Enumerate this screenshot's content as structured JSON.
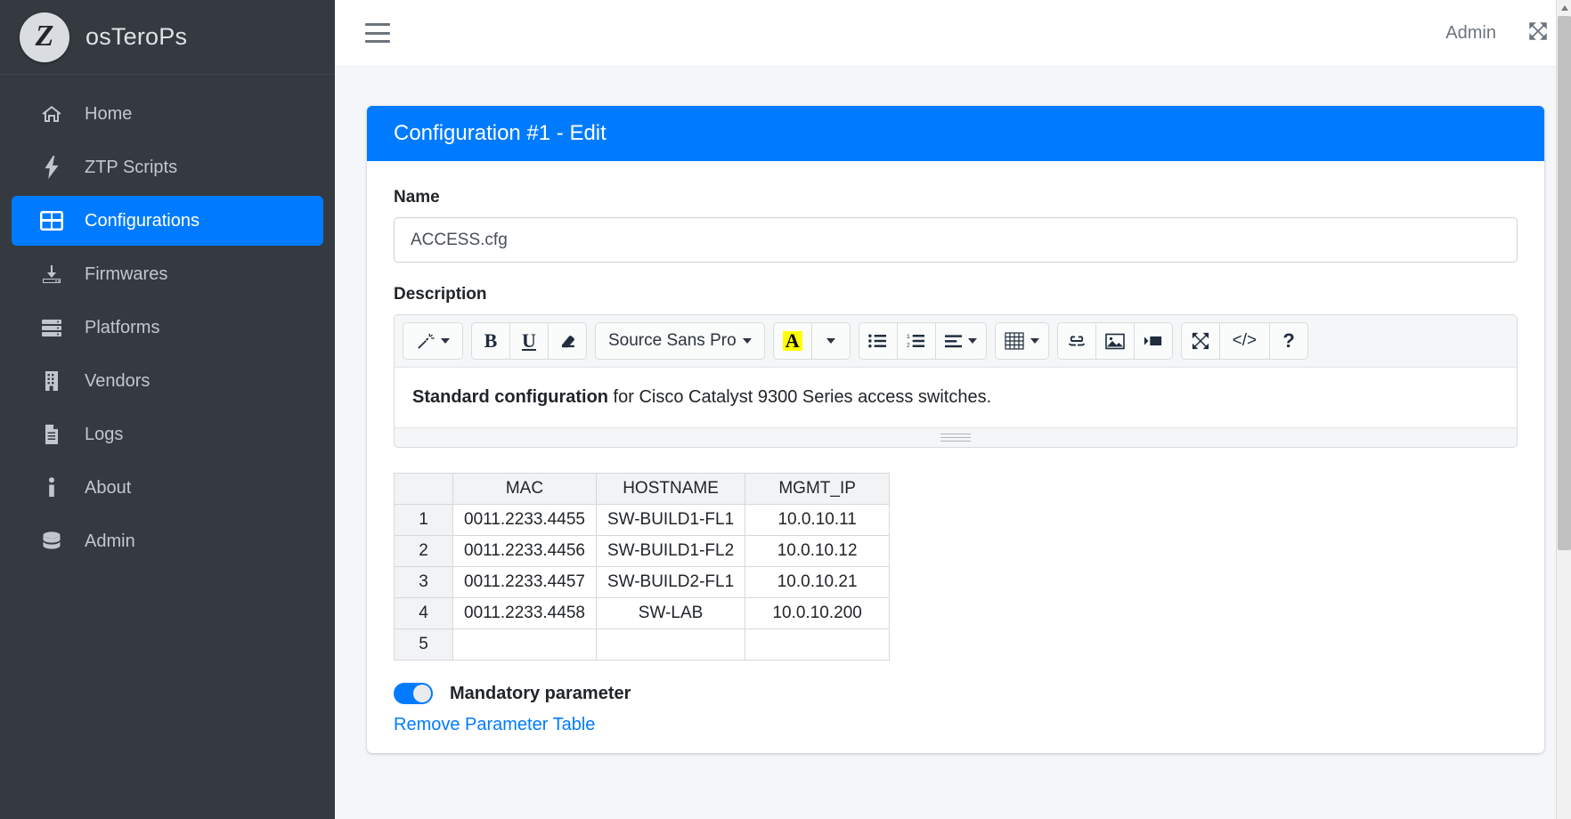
{
  "brand": {
    "logo_letter": "Z",
    "title": "osTeroPs"
  },
  "sidebar": {
    "items": [
      {
        "label": "Home",
        "icon": "home-icon",
        "active": false
      },
      {
        "label": "ZTP Scripts",
        "icon": "bolt-icon",
        "active": false
      },
      {
        "label": "Configurations",
        "icon": "table-icon",
        "active": true
      },
      {
        "label": "Firmwares",
        "icon": "download-icon",
        "active": false
      },
      {
        "label": "Platforms",
        "icon": "server-icon",
        "active": false
      },
      {
        "label": "Vendors",
        "icon": "building-icon",
        "active": false
      },
      {
        "label": "Logs",
        "icon": "file-lines-icon",
        "active": false
      },
      {
        "label": "About",
        "icon": "info-icon",
        "active": false
      },
      {
        "label": "Admin",
        "icon": "database-icon",
        "active": false
      }
    ],
    "active_color": "#007bff",
    "background": "#343a40"
  },
  "topbar": {
    "menu_icon": "hamburger-icon",
    "user_label": "Admin",
    "expand_icon": "expand-arrows-icon"
  },
  "card": {
    "header_title": "Configuration #1 - Edit",
    "header_color": "#007bff"
  },
  "form": {
    "name_label": "Name",
    "name_value": "ACCESS.cfg",
    "name_placeholder": "Name",
    "description_label": "Description"
  },
  "editor": {
    "toolbar": {
      "style_button": "magic-wand",
      "bold_label": "B",
      "underline_label": "U",
      "eraser_label": "eraser",
      "font_name": "Source Sans Pro",
      "highlight_label": "A",
      "unordered_list": "ul-icon",
      "ordered_list": "ol-icon",
      "paragraph_align": "align-icon",
      "table_label": "table-icon",
      "link_label": "link-icon",
      "picture_label": "picture-icon",
      "video_label": "video-icon",
      "fullscreen_label": "fullscreen-icon",
      "code_label": "</>",
      "help_label": "?"
    },
    "content_bold": "Standard configuration",
    "content_rest": " for Cisco Catalyst 9300 Series access switches."
  },
  "param_table": {
    "columns": [
      "",
      "MAC",
      "HOSTNAME",
      "MGMT_IP"
    ],
    "rows": [
      {
        "idx": "1",
        "mac": "0011.2233.4455",
        "hostname": "SW-BUILD1-FL1",
        "mgmt_ip": "10.0.10.11"
      },
      {
        "idx": "2",
        "mac": "0011.2233.4456",
        "hostname": "SW-BUILD1-FL2",
        "mgmt_ip": "10.0.10.12"
      },
      {
        "idx": "3",
        "mac": "0011.2233.4457",
        "hostname": "SW-BUILD2-FL1",
        "mgmt_ip": "10.0.10.21"
      },
      {
        "idx": "4",
        "mac": "0011.2233.4458",
        "hostname": "SW-LAB",
        "mgmt_ip": "10.0.10.200"
      },
      {
        "idx": "5",
        "mac": "",
        "hostname": "",
        "mgmt_ip": ""
      }
    ]
  },
  "options": {
    "mandatory_toggle_label": "Mandatory parameter",
    "mandatory_toggle_on": true,
    "remove_table_link": "Remove Parameter Table"
  }
}
